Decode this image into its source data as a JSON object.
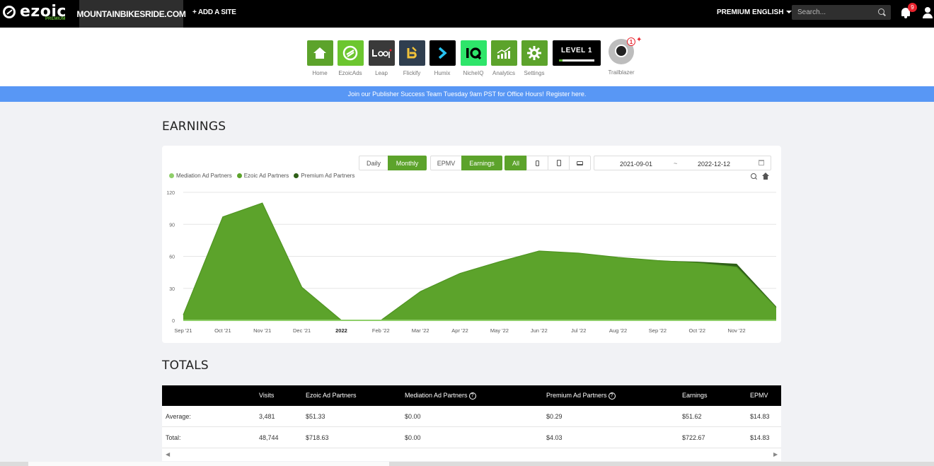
{
  "topbar": {
    "logo_text": "ezoic",
    "logo_sub": "PREMIUM",
    "site": "MOUNTAINBIKESRIDE.COM",
    "add_site": "+ ADD A SITE",
    "premium": "PREMIUM",
    "language": "ENGLISH",
    "search_placeholder": "Search...",
    "notifications": "9"
  },
  "apps": [
    {
      "label": "Home",
      "color": "#5ca32b"
    },
    {
      "label": "EzoicAds",
      "color": "#6cc62f"
    },
    {
      "label": "Leap",
      "color": "#3a3a3a"
    },
    {
      "label": "Flickify",
      "color": "#2f3e4f"
    },
    {
      "label": "Humix",
      "color": "#000000"
    },
    {
      "label": "NicheIQ",
      "color": "#2ee56a"
    },
    {
      "label": "Analytics",
      "color": "#5ca32b"
    },
    {
      "label": "Settings",
      "color": "#5ca32b"
    }
  ],
  "level": {
    "label": "LEVEL 1",
    "progress": 0.1
  },
  "trailblazer": {
    "label": "Trailblazer",
    "badge": "1"
  },
  "banner": {
    "text": "Join our Publisher Success Team Tuesday 9am PST for Office Hours!",
    "link": "Register here."
  },
  "earnings": {
    "title": "EARNINGS",
    "buttons": {
      "daily": "Daily",
      "monthly": "Monthly",
      "epmv": "EPMV",
      "earnings": "Earnings",
      "all": "All"
    },
    "date_start": "2021-09-01",
    "date_sep": "~",
    "date_end": "2022-12-12"
  },
  "colors": {
    "mediation": "#8fcf6a",
    "ezoic": "#5ca32b",
    "premium": "#2e5f17"
  },
  "chart_data": {
    "type": "area",
    "categories": [
      "Sep '21",
      "Oct '21",
      "Nov '21",
      "Dec '21",
      "2022",
      "Feb '22",
      "Mar '22",
      "Apr '22",
      "May '22",
      "Jun '22",
      "Jul '22",
      "Aug '22",
      "Sep '22",
      "Oct '22",
      "Nov '22",
      "Dec '22"
    ],
    "x_tick_labels": [
      "Sep '21",
      "Oct '21",
      "Nov '21",
      "Dec '21",
      "2022",
      "Feb '22",
      "Mar '22",
      "Apr '22",
      "May '22",
      "Jun '22",
      "Jul '22",
      "Aug '22",
      "Sep '22",
      "Oct '22",
      "Nov '22"
    ],
    "series": [
      {
        "name": "Mediation Ad Partners",
        "values": [
          0,
          0,
          0,
          0,
          0,
          0,
          0,
          0,
          0,
          0,
          0,
          0,
          0,
          0,
          0,
          0
        ]
      },
      {
        "name": "Ezoic Ad Partners",
        "values": [
          5,
          97,
          110,
          31,
          0,
          0,
          27,
          44,
          55,
          65,
          63,
          59,
          56,
          54,
          50,
          12
        ]
      },
      {
        "name": "Premium Ad Partners",
        "values": [
          0,
          0,
          0,
          0,
          0,
          0,
          0,
          0,
          0,
          0,
          0,
          0,
          0,
          1,
          3,
          1
        ]
      }
    ],
    "yticks": [
      "0",
      "30",
      "60",
      "90",
      "120"
    ],
    "ylim": [
      0,
      120
    ],
    "grid": true,
    "legend_position": "top-left"
  },
  "totals": {
    "title": "TOTALS",
    "headers": [
      "Visits",
      "Ezoic Ad Partners",
      "Mediation Ad Partners",
      "Premium Ad Partners",
      "Earnings",
      "EPMV"
    ],
    "rows": [
      {
        "label": "Average:",
        "cells": [
          "3,481",
          "$51.33",
          "$0.00",
          "$0.29",
          "$51.62",
          "$14.83"
        ]
      },
      {
        "label": "Total:",
        "cells": [
          "48,744",
          "$718.63",
          "$0.00",
          "$4.03",
          "$722.67",
          "$14.83"
        ]
      }
    ]
  }
}
